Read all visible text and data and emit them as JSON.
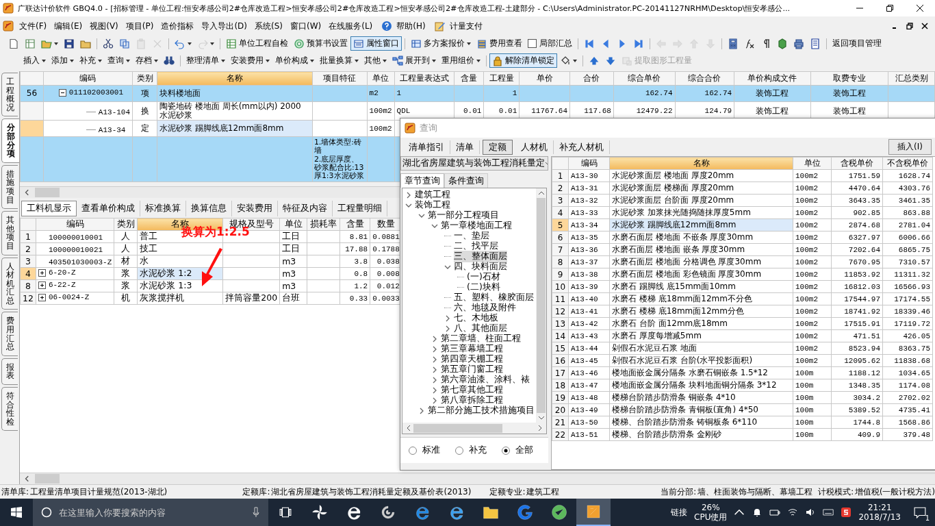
{
  "window": {
    "title": "广联达计价软件 GBQ4.0 - [招标管理 - 单位工程:恒安孝感公司2#仓库改造工程>恒安孝感公司2#仓库改造工程>恒安孝感公司2#仓库改造工程-土建部分 - C:\\Users\\Administrator.PC-20141127NRHM\\Desktop\\恒安孝感公..."
  },
  "menu": [
    "文件(F)",
    "编辑(E)",
    "视图(V)",
    "项目(P)",
    "造价指标",
    "导入导出(D)",
    "系统(S)",
    "窗口(W)",
    "在线服务(L)",
    "帮助(H)",
    "计量支付"
  ],
  "toolbars": [
    [
      {
        "kind": "icon"
      },
      {
        "kind": "icon"
      },
      {
        "kind": "icon",
        "dropdown": true
      },
      {
        "kind": "icon"
      },
      {
        "kind": "icon"
      },
      {
        "kind": "sep"
      },
      {
        "kind": "icon"
      },
      {
        "kind": "icon"
      },
      {
        "kind": "icon",
        "disabled": true
      },
      {
        "kind": "icon",
        "disabled": true
      },
      {
        "kind": "sep"
      },
      {
        "kind": "icon",
        "dropdown": true
      },
      {
        "kind": "icon",
        "dropdown": true,
        "disabled": true
      },
      {
        "kind": "sep"
      },
      {
        "kind": "icon-label",
        "label": "单位工程自检"
      },
      {
        "kind": "icon-label",
        "label": "预算书设置"
      },
      {
        "kind": "icon-label",
        "label": "属性窗口",
        "pressed": true
      },
      {
        "kind": "sep"
      },
      {
        "kind": "icon-label",
        "label": "多方案报价",
        "dropdown": true
      },
      {
        "kind": "icon-label",
        "label": "费用查看"
      },
      {
        "kind": "check",
        "label": "局部汇总",
        "checked": false
      },
      {
        "kind": "sep"
      },
      {
        "kind": "icon"
      },
      {
        "kind": "icon"
      },
      {
        "kind": "icon"
      },
      {
        "kind": "icon"
      },
      {
        "kind": "sep"
      },
      {
        "kind": "icon",
        "disabled": true
      },
      {
        "kind": "icon",
        "disabled": true
      },
      {
        "kind": "icon",
        "disabled": true
      },
      {
        "kind": "icon",
        "disabled": true
      },
      {
        "kind": "sep"
      },
      {
        "kind": "icon"
      },
      {
        "kind": "icon"
      },
      {
        "kind": "icon"
      },
      {
        "kind": "icon"
      },
      {
        "kind": "icon"
      },
      {
        "kind": "icon"
      },
      {
        "kind": "sep"
      },
      {
        "kind": "label",
        "label": "返回项目管理"
      }
    ],
    [
      {
        "kind": "label",
        "label": "插入",
        "dropdown": true
      },
      {
        "kind": "label",
        "label": "添加",
        "dropdown": true
      },
      {
        "kind": "label",
        "label": "补充",
        "dropdown": true
      },
      {
        "kind": "label",
        "label": "查询",
        "dropdown": true
      },
      {
        "kind": "label",
        "label": "存档",
        "dropdown": true
      },
      {
        "kind": "icon"
      },
      {
        "kind": "sep"
      },
      {
        "kind": "label",
        "label": "整理清单",
        "dropdown": true
      },
      {
        "kind": "label",
        "label": "安装费用",
        "dropdown": true
      },
      {
        "kind": "label",
        "label": "单价构成",
        "dropdown": true
      },
      {
        "kind": "label",
        "label": "批量换算",
        "dropdown": true
      },
      {
        "kind": "label",
        "label": "其他",
        "dropdown": true
      },
      {
        "kind": "icon-label",
        "label": "展开到",
        "dropdown": true
      },
      {
        "kind": "label",
        "label": "重用组价",
        "dropdown": true
      },
      {
        "kind": "sep"
      },
      {
        "kind": "icon-label",
        "label": "解除清单锁定",
        "pressed": true
      },
      {
        "kind": "icon",
        "dropdown": true
      },
      {
        "kind": "sep"
      },
      {
        "kind": "icon"
      },
      {
        "kind": "icon"
      },
      {
        "kind": "icon-label",
        "label": "提取图形工程量",
        "disabled": true
      }
    ]
  ],
  "side_tabs": [
    {
      "label": "工程概况",
      "selected": false
    },
    {
      "label": "分部分项",
      "selected": true
    },
    {
      "label": "措施项目",
      "selected": false
    },
    {
      "label": "其他项目",
      "selected": false
    },
    {
      "label": "人材机汇总",
      "selected": false
    },
    {
      "label": "费用汇总",
      "selected": false
    },
    {
      "label": "报表",
      "selected": false
    },
    {
      "label": "符合性检",
      "selected": false
    }
  ],
  "bill_table": {
    "columns": [
      "编码",
      "类别",
      "名称",
      "项目特征",
      "单位",
      "工程量表达式",
      "含量",
      "工程量",
      "单价",
      "合价",
      "综合单价",
      "综合合价",
      "单价构成文件",
      "取费专业",
      "汇总类别"
    ],
    "rows": [
      {
        "num": "56",
        "code": "011102003001",
        "type": "项",
        "name": "块料楼地面",
        "unit": "m2",
        "expression": "1",
        "quantity": "1",
        "composite_price": "162.74",
        "composite_total": "162.74",
        "price_file": "装饰工程",
        "fee_type": "装饰工程",
        "selected": true,
        "current": false,
        "expanded": true,
        "children": [
          {
            "code": "A13-104",
            "type": "换",
            "name": "陶瓷地砖 楼地面 周长(mm以内) 2000 水泥砂浆",
            "unit": "100m2",
            "expression": "QDL",
            "content": "0.01",
            "quantity": "0.01",
            "unit_price": "11767.64",
            "total": "117.68",
            "composite_price": "12479.22",
            "composite_total": "124.79",
            "price_file": "装饰工程",
            "fee_type": "装饰工程",
            "selected": false,
            "current": false
          },
          {
            "code": "A13-34",
            "type": "定",
            "name": "水泥砂浆 踢脚线底12mm面8mm",
            "unit": "100m2",
            "selected": false,
            "current": true
          }
        ]
      },
      {
        "feature": "1.墙体类型:砖墙\n2.底层厚度、砂浆配合比:13厚1:3水泥砂浆",
        "selected": true,
        "current": false
      }
    ]
  },
  "detail_tabs": [
    {
      "label": "工料机显示",
      "selected": true
    },
    {
      "label": "查看单价构成",
      "selected": false
    },
    {
      "label": "标准换算",
      "selected": false
    },
    {
      "label": "换算信息",
      "selected": false
    },
    {
      "label": "安装费用",
      "selected": false
    },
    {
      "label": "特征及内容",
      "selected": false
    },
    {
      "label": "工程量明细",
      "selected": false
    }
  ],
  "resource_table": {
    "columns": [
      "编码",
      "类别",
      "名称",
      "规格及型号",
      "单位",
      "损耗率",
      "含量",
      "数量"
    ],
    "rows": [
      {
        "num": "1",
        "code": "100000010001",
        "type": "人",
        "name": "普工",
        "unit": "工日",
        "content": "8.81",
        "amount": "0.0881",
        "current": false
      },
      {
        "num": "2",
        "code": "100000010021",
        "type": "人",
        "name": "技工",
        "unit": "工日",
        "content": "17.88",
        "amount": "0.1788",
        "current": false
      },
      {
        "num": "3",
        "code": "403501030003-Z",
        "type": "材",
        "name": "水",
        "unit": "m3",
        "content": "3.8",
        "amount": "0.038",
        "current": false
      },
      {
        "num": "4",
        "code": "6-20-Z",
        "expanded": false,
        "type": "浆",
        "name": "水泥砂浆 1:2",
        "unit": "m3",
        "content": "0.8",
        "amount": "0.008",
        "current": true
      },
      {
        "num": "8",
        "code": "6-22-Z",
        "expanded": false,
        "type": "浆",
        "name": "水泥砂浆 1:3",
        "unit": "m3",
        "content": "1.2",
        "amount": "0.012",
        "current": false
      },
      {
        "num": "12",
        "code": "06-0024-Z",
        "expanded": false,
        "type": "机",
        "name": "灰浆搅拌机",
        "spec": "拌筒容量200",
        "unit": "台班",
        "content": "0.33",
        "amount": "0.0033",
        "current": false
      }
    ]
  },
  "annotation": {
    "text": "换算为1:2.5"
  },
  "query_dialog": {
    "title": "查询",
    "tabs": [
      {
        "label": "清单指引",
        "selected": false
      },
      {
        "label": "清单",
        "selected": false
      },
      {
        "label": "定额",
        "selected": true
      },
      {
        "label": "人材机",
        "selected": false
      },
      {
        "label": "补充人材机",
        "selected": false
      }
    ],
    "insert_button": "插入(I)",
    "library": "湖北省房屋建筑与装饰工程消耗量定",
    "search_tabs": [
      {
        "label": "章节查询",
        "selected": true
      },
      {
        "label": "条件查询",
        "selected": false
      }
    ],
    "tree": [
      {
        "label": "建筑工程",
        "expanded": false,
        "selected": false
      },
      {
        "label": "装饰工程",
        "expanded": true,
        "selected": false,
        "children": [
          {
            "label": "第一部分工程项目",
            "expanded": true,
            "selected": false,
            "children": [
              {
                "label": "第一章楼地面工程",
                "expanded": true,
                "selected": false,
                "children": [
                  {
                    "label": "一、垫层",
                    "selected": false
                  },
                  {
                    "label": "二、找平层",
                    "selected": false
                  },
                  {
                    "label": "三、整体面层",
                    "selected": true
                  },
                  {
                    "label": "四、块料面层",
                    "expanded": true,
                    "selected": false,
                    "children": [
                      {
                        "label": "(一)石材",
                        "selected": false
                      },
                      {
                        "label": "(二)块料",
                        "selected": false
                      }
                    ]
                  },
                  {
                    "label": "五、塑料、橡胶面层",
                    "selected": false
                  },
                  {
                    "label": "六、地毯及附件",
                    "selected": false
                  },
                  {
                    "label": "七、木地板",
                    "expanded": false,
                    "selected": false
                  },
                  {
                    "label": "八、其他面层",
                    "expanded": false,
                    "selected": false
                  }
                ]
              },
              {
                "label": "第二章墙、柱面工程",
                "expanded": false,
                "selected": false
              },
              {
                "label": "第三章幕墙工程",
                "expanded": false,
                "selected": false
              },
              {
                "label": "第四章天棚工程",
                "expanded": false,
                "selected": false
              },
              {
                "label": "第五章门窗工程",
                "expanded": false,
                "selected": false
              },
              {
                "label": "第六章油漆、涂料、裱",
                "expanded": false,
                "selected": false
              },
              {
                "label": "第七章其他工程",
                "expanded": false,
                "selected": false
              },
              {
                "label": "第八章拆除工程",
                "expanded": false,
                "selected": false
              }
            ]
          },
          {
            "label": "第二部分施工技术措施项目",
            "expanded": false,
            "selected": false
          }
        ]
      }
    ],
    "filters": [
      {
        "label": "标准",
        "selected": false
      },
      {
        "label": "补充",
        "selected": false
      },
      {
        "label": "全部",
        "selected": true
      }
    ],
    "columns": [
      "编码",
      "名称",
      "单位",
      "含税单价",
      "不含税单价"
    ],
    "rows": [
      {
        "num": "1",
        "code": "A13-30",
        "name": "水泥砂浆面层 楼地面 厚度20mm",
        "unit": "100m2",
        "tax_price": "1751.59",
        "price": "1628.74",
        "selected": false
      },
      {
        "num": "2",
        "code": "A13-31",
        "name": "水泥砂浆面层 楼梯面 厚度20mm",
        "unit": "100m2",
        "tax_price": "4470.64",
        "price": "4303.76",
        "selected": false
      },
      {
        "num": "3",
        "code": "A13-32",
        "name": "水泥砂浆面层 台阶面 厚度20mm",
        "unit": "100m2",
        "tax_price": "3643.35",
        "price": "3461.35",
        "selected": false
      },
      {
        "num": "4",
        "code": "A13-33",
        "name": "水泥砂浆 加浆抹光随捣随抹厚度5mm",
        "unit": "100m2",
        "tax_price": "902.85",
        "price": "863.88",
        "selected": false
      },
      {
        "num": "5",
        "code": "A13-34",
        "name": "水泥砂浆 踢脚线底12mm面8mm",
        "unit": "100m2",
        "tax_price": "2874.68",
        "price": "2781.04",
        "selected": true
      },
      {
        "num": "6",
        "code": "A13-35",
        "name": "水磨石面层 楼地面 不嵌条 厚度30mm",
        "unit": "100m2",
        "tax_price": "6327.97",
        "price": "6006.66",
        "selected": false
      },
      {
        "num": "7",
        "code": "A13-36",
        "name": "水磨石面层 楼地面 嵌条 厚度30mm",
        "unit": "100m2",
        "tax_price": "7202.64",
        "price": "6865.75",
        "selected": false
      },
      {
        "num": "8",
        "code": "A13-37",
        "name": "水磨石面层 楼地面 分格调色 厚度30mm",
        "unit": "100m2",
        "tax_price": "7670.95",
        "price": "7310.57",
        "selected": false
      },
      {
        "num": "9",
        "code": "A13-38",
        "name": "水磨石面层 楼地面 彩色镜面 厚度30mm",
        "unit": "100m2",
        "tax_price": "11853.92",
        "price": "11311.32",
        "selected": false
      },
      {
        "num": "10",
        "code": "A13-39",
        "name": "水磨石 踢脚线 底15mm面10mm",
        "unit": "100m2",
        "tax_price": "16812.03",
        "price": "16566.93",
        "selected": false
      },
      {
        "num": "11",
        "code": "A13-40",
        "name": "水磨石 楼梯 底18mm面12mm不分色",
        "unit": "100m2",
        "tax_price": "17544.97",
        "price": "17174.55",
        "selected": false
      },
      {
        "num": "12",
        "code": "A13-41",
        "name": "水磨石 楼梯 底18mm面12mm分色",
        "unit": "100m2",
        "tax_price": "18741.92",
        "price": "18339.46",
        "selected": false
      },
      {
        "num": "13",
        "code": "A13-42",
        "name": "水磨石 台阶 面12mm底18mm",
        "unit": "100m2",
        "tax_price": "17515.91",
        "price": "17119.72",
        "selected": false
      },
      {
        "num": "14",
        "code": "A13-43",
        "name": "水磨石 厚度每增减5mm",
        "unit": "100m2",
        "tax_price": "471.51",
        "price": "426.05",
        "selected": false
      },
      {
        "num": "15",
        "code": "A13-44",
        "name": "剁假石水泥豆石浆 地面",
        "unit": "100m2",
        "tax_price": "8523.94",
        "price": "8363.75",
        "selected": false
      },
      {
        "num": "16",
        "code": "A13-45",
        "name": "剁假石水泥豆石浆 台阶(水平投影面积)",
        "unit": "100m2",
        "tax_price": "12095.62",
        "price": "11838.68",
        "selected": false
      },
      {
        "num": "17",
        "code": "A13-46",
        "name": "楼地面嵌金属分隔条 水磨石铜嵌条 1.5*12",
        "unit": "100m",
        "tax_price": "1188.12",
        "price": "1034.65",
        "selected": false
      },
      {
        "num": "18",
        "code": "A13-47",
        "name": "楼地面嵌金属分隔条 块料地面铜分隔条 3*12",
        "unit": "100m",
        "tax_price": "1348.35",
        "price": "1174.08",
        "selected": false
      },
      {
        "num": "19",
        "code": "A13-48",
        "name": "楼梯台阶踏步防滑条 铜嵌条 4*10",
        "unit": "100m",
        "tax_price": "3034.2",
        "price": "2702.02",
        "selected": false
      },
      {
        "num": "20",
        "code": "A13-49",
        "name": "楼梯台阶踏步防滑条 青铜板(直角) 4*50",
        "unit": "100m",
        "tax_price": "5389.52",
        "price": "4735.41",
        "selected": false
      },
      {
        "num": "21",
        "code": "A13-50",
        "name": "楼梯、台阶踏步防滑条 铸铜板条 6*110",
        "unit": "100m",
        "tax_price": "1744.8",
        "price": "1568.86",
        "selected": false
      },
      {
        "num": "22",
        "code": "A13-51",
        "name": "楼梯、台阶踏步防滑条 金刚砂",
        "unit": "100m",
        "tax_price": "409.9",
        "price": "379.48",
        "selected": false
      }
    ]
  },
  "status_bar": [
    {
      "label": "清单库:",
      "value": "工程量清单项目计量规范(2013-湖北)"
    },
    {
      "label": "定额库:",
      "value": "湖北省房屋建筑与装饰工程消耗量定额及基价表(2013)"
    },
    {
      "label": "定额专业:",
      "value": "建筑工程"
    },
    {
      "label": "当前分部:",
      "value": "墙、柱面装饰与隔断、幕墙工程"
    },
    {
      "label": "计税模式:",
      "value": "增值税(一般计税方法)"
    }
  ],
  "taskbar": {
    "search_placeholder": "在这里输入你要搜索的内容",
    "apps": [
      {
        "active": false
      },
      {
        "active": false
      },
      {
        "active": false
      },
      {
        "active": false
      },
      {
        "active": false
      },
      {
        "active": false
      },
      {
        "active": false
      },
      {
        "active": false
      },
      {
        "active": true
      }
    ],
    "link_label": "链接",
    "cpu_value": "26%",
    "cpu_label": "CPU使用",
    "time": "21:21",
    "date": "2018/7/13",
    "notifications": "1"
  }
}
